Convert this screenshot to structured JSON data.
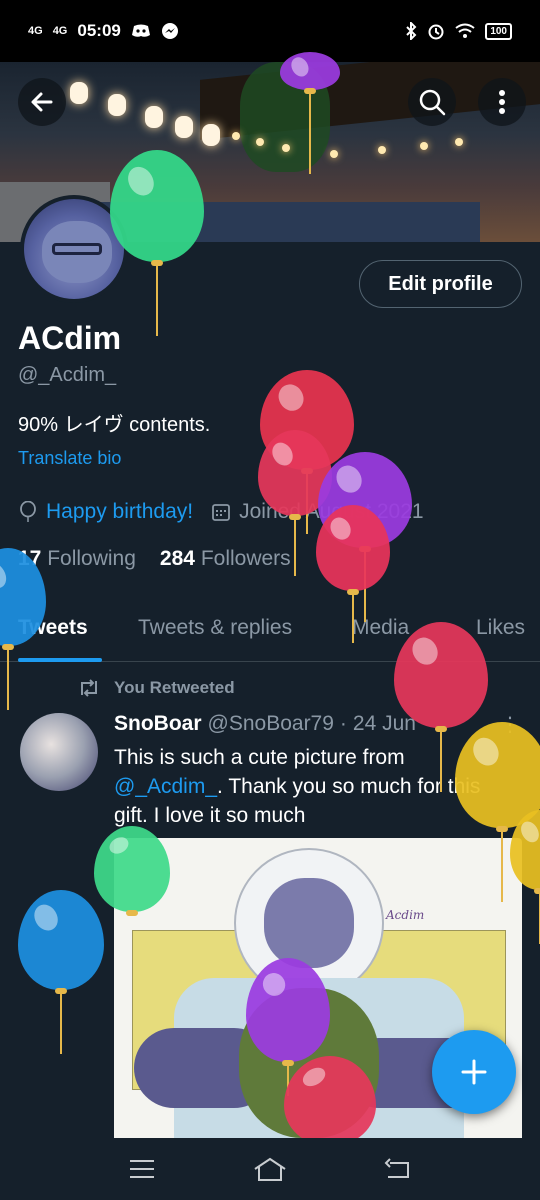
{
  "status_bar": {
    "net1": "4G",
    "net2": "4G",
    "time": "05:09",
    "battery": "100"
  },
  "profile": {
    "display_name": "ACdim",
    "handle": "@_Acdim_",
    "bio": "90% レイヴ  contents.",
    "translate_label": "Translate bio",
    "edit_button": "Edit profile",
    "birthday_text": "Happy birthday!",
    "joined_text": "Joined August 2021",
    "following_count": "17",
    "following_label": "Following",
    "followers_count": "284",
    "followers_label": "Followers"
  },
  "tabs": [
    {
      "label": "Tweets",
      "active": true
    },
    {
      "label": "Tweets & replies",
      "active": false
    },
    {
      "label": "Media",
      "active": false
    },
    {
      "label": "Likes",
      "active": false
    }
  ],
  "retweet_label": "You Retweeted",
  "tweet": {
    "author": "SnoBoar",
    "handle": "@SnoBoar79",
    "separator": "·",
    "date": "24 Jun",
    "menu": "⋮",
    "text_1": "This is such a cute picture from",
    "mention": "@_Acdim_",
    "text_2": ". Thank you so much for this gift. I love it so much",
    "image_signature": "Acdim"
  },
  "colors": {
    "background": "#15202b",
    "accent": "#1d9bf0",
    "muted": "#8b98a5"
  },
  "icons": {
    "back": "arrow-left-icon",
    "search": "search-icon",
    "more": "more-vertical-icon",
    "birthday": "balloon-icon",
    "calendar": "calendar-icon",
    "retweet": "retweet-icon",
    "compose": "plus-icon"
  }
}
